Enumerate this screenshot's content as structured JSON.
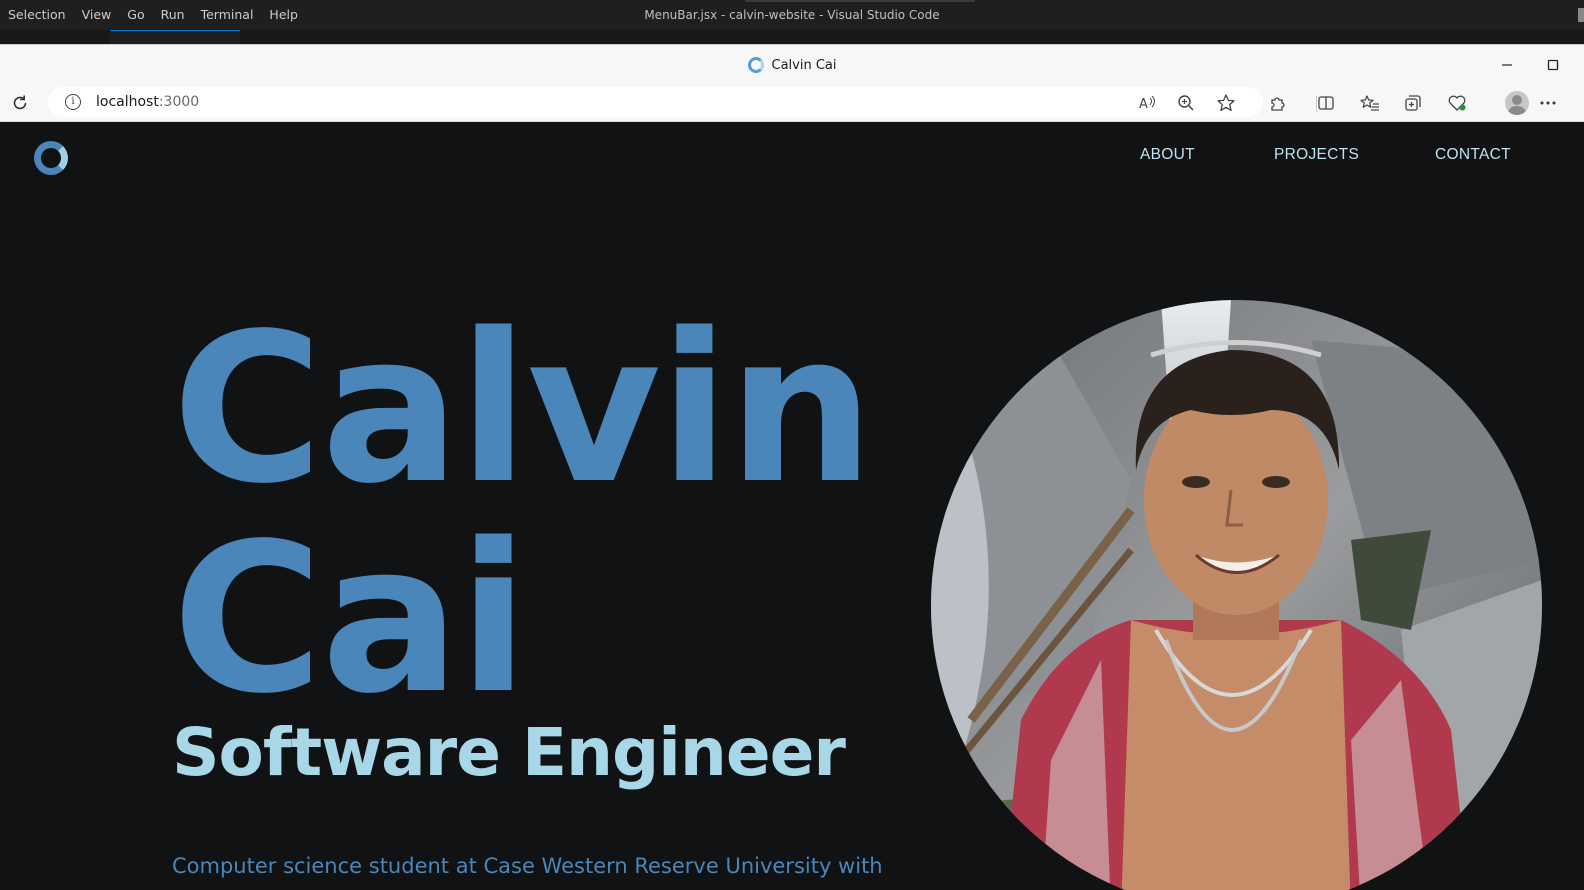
{
  "vscode": {
    "menu": [
      "Selection",
      "View",
      "Go",
      "Run",
      "Terminal",
      "Help"
    ],
    "title": "MenuBar.jsx - calvin-website - Visual Studio Code"
  },
  "browser": {
    "tab_title": "Calvin Cai",
    "url_host": "localhost",
    "url_port": ":3000"
  },
  "site": {
    "nav": [
      "ABOUT",
      "PROJECTS",
      "CONTACT"
    ],
    "hero": {
      "first_name": "Calvin",
      "last_name": "Cai",
      "role": "Software Engineer",
      "description": "Computer science student at Case Western Reserve University with"
    }
  },
  "colors": {
    "background": "#111213",
    "primary_blue": "#4a86b9",
    "light_blue": "#a8d8e8",
    "nav_text": "#bfe3ef"
  },
  "icons": [
    "reload-icon",
    "info-icon",
    "read-aloud-icon",
    "zoom-icon",
    "favorite-star-icon",
    "extensions-icon",
    "split-screen-icon",
    "favorites-icon",
    "collections-icon",
    "browser-essentials-icon",
    "profile-avatar-icon",
    "more-options-icon"
  ]
}
